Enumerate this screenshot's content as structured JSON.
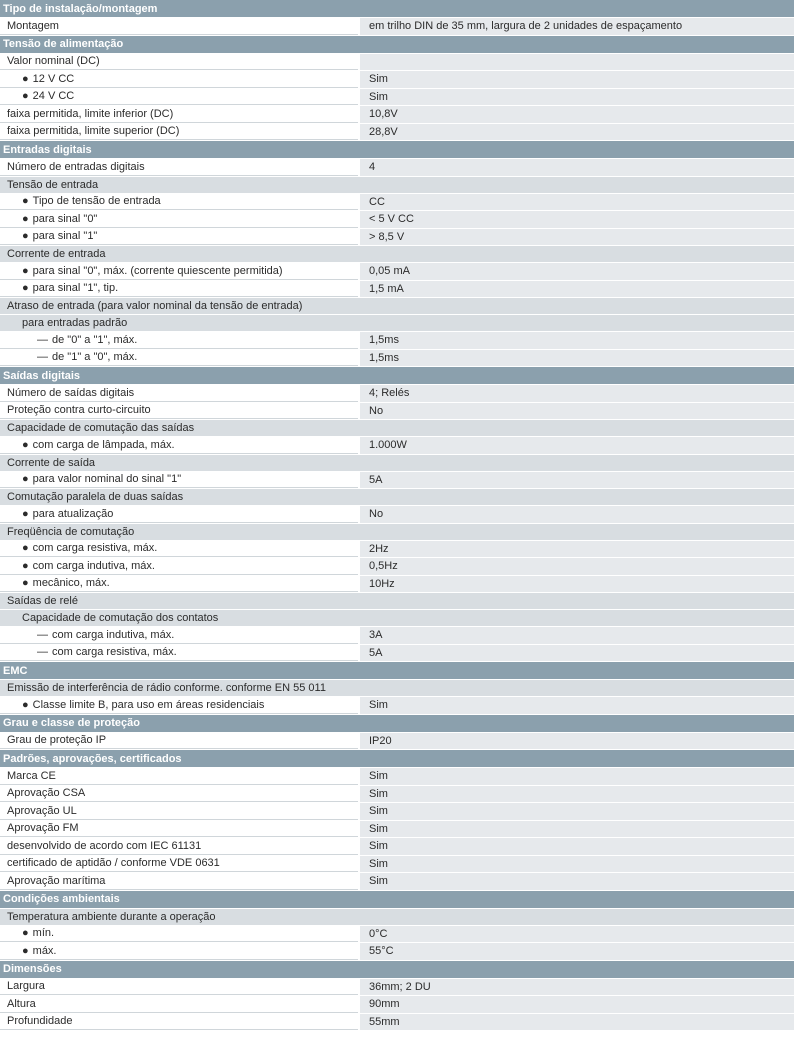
{
  "rows": [
    {
      "type": "section",
      "text": "Tipo de instalação/montagem"
    },
    {
      "type": "item",
      "label": "Montagem",
      "value": "em trilho DIN de 35 mm, largura de 2 unidades de espaçamento",
      "indent": 0
    },
    {
      "type": "section",
      "text": "Tensão de alimentação"
    },
    {
      "type": "item",
      "label": "Valor nominal (DC)",
      "value": "",
      "indent": 0
    },
    {
      "type": "item",
      "label": "12 V CC",
      "value": "Sim",
      "indent": 1,
      "marker": "●"
    },
    {
      "type": "item",
      "label": "24 V CC",
      "value": "Sim",
      "indent": 1,
      "marker": "●"
    },
    {
      "type": "item",
      "label": "faixa permitida, limite inferior (DC)",
      "value": "10,8V",
      "indent": 0
    },
    {
      "type": "item",
      "label": "faixa permitida, limite superior (DC)",
      "value": "28,8V",
      "indent": 0
    },
    {
      "type": "section",
      "text": "Entradas digitais"
    },
    {
      "type": "item",
      "label": "Número de entradas digitais",
      "value": "4",
      "indent": 0
    },
    {
      "type": "sub",
      "text": "Tensão de entrada",
      "indent": 0
    },
    {
      "type": "item",
      "label": "Tipo de tensão de entrada",
      "value": "CC",
      "indent": 1,
      "marker": "●"
    },
    {
      "type": "item",
      "label": "para sinal \"0\"",
      "value": "< 5 V CC",
      "indent": 1,
      "marker": "●"
    },
    {
      "type": "item",
      "label": "para sinal \"1\"",
      "value": "> 8,5 V",
      "indent": 1,
      "marker": "●"
    },
    {
      "type": "sub",
      "text": "Corrente de entrada",
      "indent": 0
    },
    {
      "type": "item",
      "label": "para sinal \"0\", máx. (corrente quiescente permitida)",
      "value": "0,05 mA",
      "indent": 1,
      "marker": "●"
    },
    {
      "type": "item",
      "label": "para sinal \"1\", tip.",
      "value": "1,5 mA",
      "indent": 1,
      "marker": "●"
    },
    {
      "type": "sub",
      "text": "Atraso de entrada (para valor nominal da tensão de entrada)",
      "indent": 0
    },
    {
      "type": "sub",
      "text": "para entradas padrão",
      "indent": 1
    },
    {
      "type": "item",
      "label": "de \"0\" a \"1\", máx.",
      "value": "1,5ms",
      "indent": 2,
      "marker": "—"
    },
    {
      "type": "item",
      "label": "de \"1\" a \"0\", máx.",
      "value": "1,5ms",
      "indent": 2,
      "marker": "—"
    },
    {
      "type": "section",
      "text": "Saídas digitais"
    },
    {
      "type": "item",
      "label": "Número de saídas digitais",
      "value": "4; Relés",
      "indent": 0
    },
    {
      "type": "item",
      "label": "Proteção contra curto-circuito",
      "value": "No",
      "indent": 0
    },
    {
      "type": "sub",
      "text": "Capacidade de comutação das saídas",
      "indent": 0
    },
    {
      "type": "item",
      "label": "com carga de lâmpada, máx.",
      "value": "1.000W",
      "indent": 1,
      "marker": "●"
    },
    {
      "type": "sub",
      "text": "Corrente de saída",
      "indent": 0
    },
    {
      "type": "item",
      "label": "para valor nominal do sinal \"1\"",
      "value": "5A",
      "indent": 1,
      "marker": "●"
    },
    {
      "type": "sub",
      "text": "Comutação paralela de duas saídas",
      "indent": 0
    },
    {
      "type": "item",
      "label": "para atualização",
      "value": "No",
      "indent": 1,
      "marker": "●"
    },
    {
      "type": "sub",
      "text": "Freqüência de comutação",
      "indent": 0
    },
    {
      "type": "item",
      "label": "com carga resistiva, máx.",
      "value": "2Hz",
      "indent": 1,
      "marker": "●"
    },
    {
      "type": "item",
      "label": "com carga indutiva, máx.",
      "value": "0,5Hz",
      "indent": 1,
      "marker": "●"
    },
    {
      "type": "item",
      "label": "mecânico, máx.",
      "value": "10Hz",
      "indent": 1,
      "marker": "●"
    },
    {
      "type": "sub",
      "text": "Saídas de relé",
      "indent": 0
    },
    {
      "type": "sub",
      "text": "Capacidade de comutação dos contatos",
      "indent": 1
    },
    {
      "type": "item",
      "label": "com carga indutiva, máx.",
      "value": "3A",
      "indent": 2,
      "marker": "—"
    },
    {
      "type": "item",
      "label": "com carga resistiva, máx.",
      "value": "5A",
      "indent": 2,
      "marker": "—"
    },
    {
      "type": "section",
      "text": "EMC"
    },
    {
      "type": "sub",
      "text": "Emissão de interferência de rádio conforme. conforme EN 55 011",
      "indent": 0
    },
    {
      "type": "item",
      "label": "Classe limite B, para uso em áreas residenciais",
      "value": "Sim",
      "indent": 1,
      "marker": "●"
    },
    {
      "type": "section",
      "text": "Grau e classe de proteção"
    },
    {
      "type": "item",
      "label": "Grau de proteção IP",
      "value": "IP20",
      "indent": 0
    },
    {
      "type": "section",
      "text": "Padrões, aprovações, certificados"
    },
    {
      "type": "item",
      "label": "Marca CE",
      "value": "Sim",
      "indent": 0
    },
    {
      "type": "item",
      "label": "Aprovação CSA",
      "value": "Sim",
      "indent": 0
    },
    {
      "type": "item",
      "label": "Aprovação UL",
      "value": "Sim",
      "indent": 0
    },
    {
      "type": "item",
      "label": "Aprovação FM",
      "value": "Sim",
      "indent": 0
    },
    {
      "type": "item",
      "label": "desenvolvido de acordo com IEC 61131",
      "value": "Sim",
      "indent": 0
    },
    {
      "type": "item",
      "label": "certificado de aptidão / conforme VDE 0631",
      "value": "Sim",
      "indent": 0
    },
    {
      "type": "item",
      "label": "Aprovação marítima",
      "value": "Sim",
      "indent": 0
    },
    {
      "type": "section",
      "text": "Condições ambientais"
    },
    {
      "type": "sub",
      "text": "Temperatura ambiente durante a operação",
      "indent": 0
    },
    {
      "type": "item",
      "label": "mín.",
      "value": "0°C",
      "indent": 1,
      "marker": "●"
    },
    {
      "type": "item",
      "label": "máx.",
      "value": "55°C",
      "indent": 1,
      "marker": "●"
    },
    {
      "type": "section",
      "text": "Dimensões"
    },
    {
      "type": "item",
      "label": "Largura",
      "value": "36mm; 2 DU",
      "indent": 0
    },
    {
      "type": "item",
      "label": "Altura",
      "value": "90mm",
      "indent": 0
    },
    {
      "type": "item",
      "label": "Profundidade",
      "value": "55mm",
      "indent": 0
    }
  ],
  "colors": {
    "section_bg": "#8ba0ad",
    "sub_bg": "#d8dde1",
    "value_bg": "#e6e9ec"
  }
}
